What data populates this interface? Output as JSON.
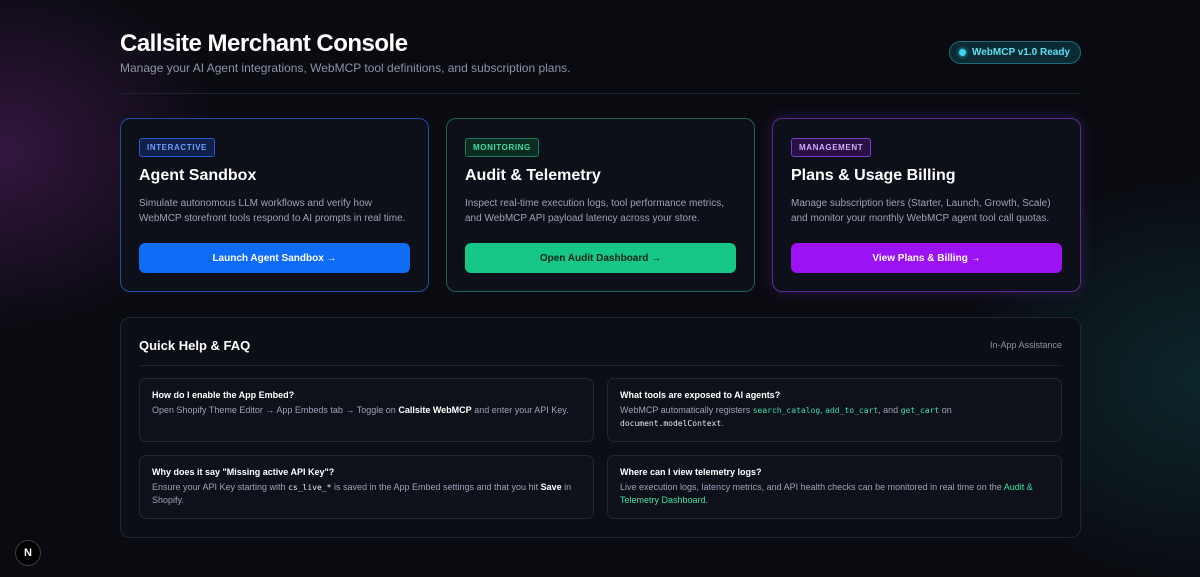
{
  "header": {
    "title": "Callsite Merchant Console",
    "subtitle": "Manage your AI Agent integrations, WebMCP tool definitions, and subscription plans.",
    "status_badge": "WebMCP v1.0 Ready"
  },
  "cards": [
    {
      "tag": "INTERACTIVE",
      "title": "Agent Sandbox",
      "description": "Simulate autonomous LLM workflows and verify how WebMCP storefront tools respond to AI prompts in real time.",
      "button": "Launch Agent Sandbox →",
      "accent": "#0e6cf6"
    },
    {
      "tag": "MONITORING",
      "title": "Audit & Telemetry",
      "description": "Inspect real-time execution logs, tool performance metrics, and WebMCP API payload latency across your store.",
      "button": "Open Audit Dashboard →",
      "accent": "#16c787"
    },
    {
      "tag": "MANAGEMENT",
      "title": "Plans & Usage Billing",
      "description": "Manage subscription tiers (Starter, Launch, Growth, Scale) and monitor your monthly WebMCP agent tool call quotas.",
      "button": "View Plans & Billing →",
      "accent": "#9b12f5"
    }
  ],
  "faq": {
    "title": "Quick Help & FAQ",
    "aside": "In-App Assistance",
    "items": [
      {
        "question": "How do I enable the App Embed?",
        "a1": "Open Shopify Theme Editor → App Embeds tab → Toggle on ",
        "a2": "Callsite WebMCP",
        "a3": " and enter your API Key."
      },
      {
        "question": "What tools are exposed to AI agents?",
        "a1": "WebMCP automatically registers ",
        "code1": "search_catalog",
        "sep1": ", ",
        "code2": "add_to_cart",
        "sep2": ", and ",
        "code3": "get_cart",
        "a2": " on ",
        "code4": "document.modelContext",
        "a3": "."
      },
      {
        "question": "Why does it say \"Missing active API Key\"?",
        "a1": "Ensure your API Key starting with ",
        "code1": "cs_live_*",
        "a2": " is saved in the App Embed settings and that you hit ",
        "bold": "Save",
        "a3": " in Shopify."
      },
      {
        "question": "Where can I view telemetry logs?",
        "a1": "Live execution logs, latency metrics, and API health checks can be monitored in real time on the ",
        "link": "Audit & Telemetry Dashboard",
        "a2": "."
      }
    ]
  },
  "next_badge": "N"
}
